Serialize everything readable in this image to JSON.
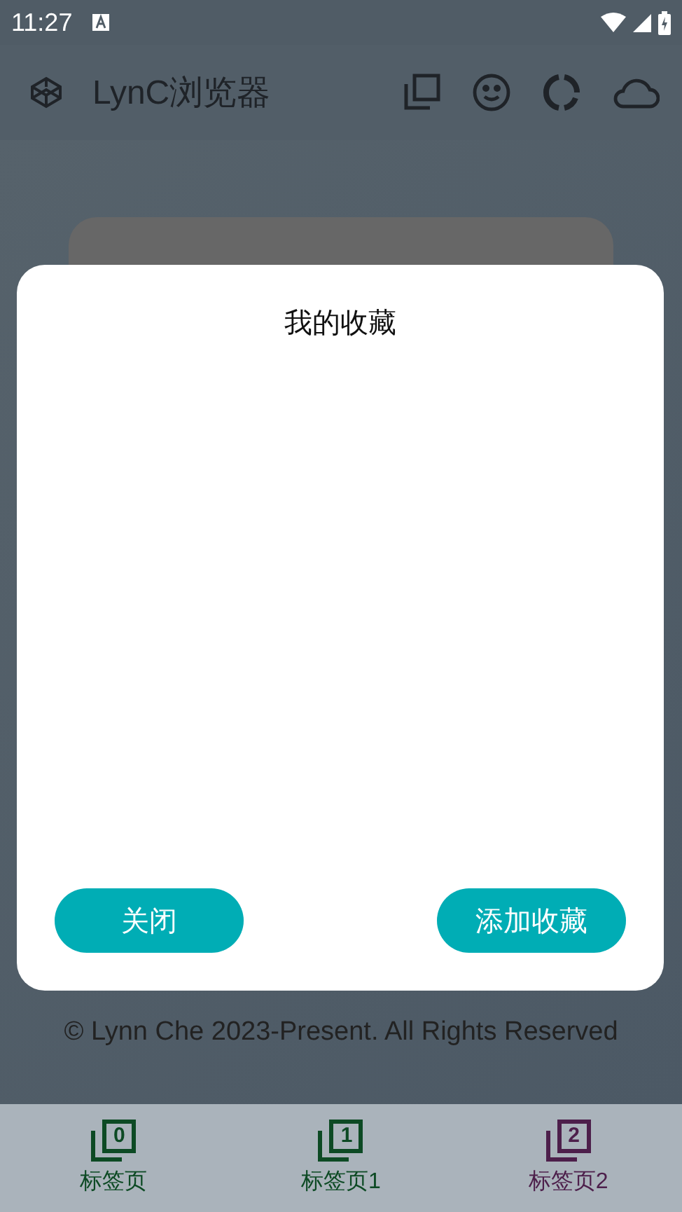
{
  "status_bar": {
    "time": "11:27"
  },
  "app_bar": {
    "title": "LynC浏览器"
  },
  "dialog": {
    "title": "我的收藏",
    "buttons": [
      {
        "label": "关闭"
      },
      {
        "label": "添加收藏"
      }
    ]
  },
  "footer": "© Lynn Che 2023-Present. All Rights Reserved",
  "bottom_tabs": [
    {
      "label": "标签页",
      "digit": "0",
      "color": "#0d4a24"
    },
    {
      "label": "标签页1",
      "digit": "1",
      "color": "#0d4a24"
    },
    {
      "label": "标签页2",
      "digit": "2",
      "color": "#4d1f4b"
    }
  ]
}
